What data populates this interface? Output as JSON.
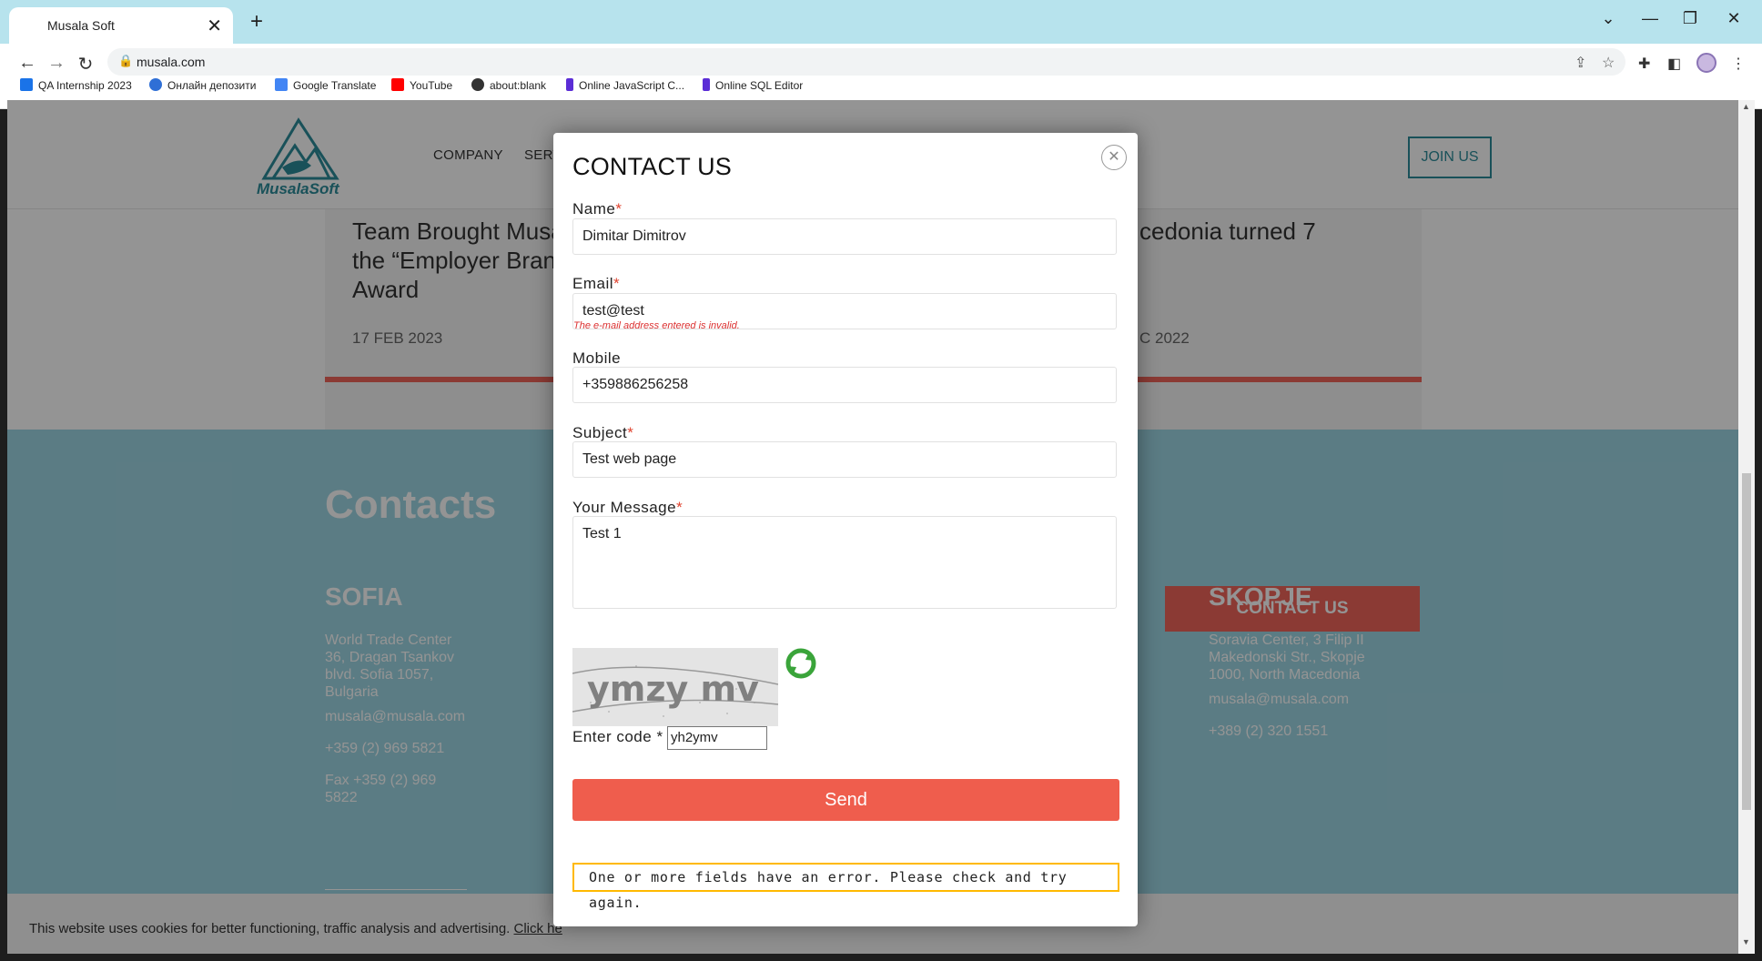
{
  "browser": {
    "tab_title": "Musala Soft",
    "url": "musala.com",
    "bookmarks": [
      {
        "label": "QA Internship 2023",
        "color": "#1a73e8"
      },
      {
        "label": "Онлайн депозити",
        "color": "#2f6fd6"
      },
      {
        "label": "Google Translate",
        "color": "#4285f4"
      },
      {
        "label": "YouTube",
        "color": "#ff0000"
      },
      {
        "label": "about:blank",
        "color": "#333333"
      },
      {
        "label": "Online JavaScript C...",
        "color": "#5b2dd6"
      },
      {
        "label": "Online SQL Editor",
        "color": "#5b2dd6"
      }
    ]
  },
  "site": {
    "logo_text": "MusalaSoft",
    "nav": [
      "COMPANY",
      "SERV"
    ],
    "join_label": "JOIN US",
    "news": [
      {
        "title": "Team Brought Musa\nthe “Employer Branc\nAward",
        "date": "17 FEB 2023"
      },
      {
        "title": "cedonia turned 7",
        "date": "C 2022"
      }
    ],
    "contacts": {
      "heading": "Contacts",
      "contact_button": "CONTACT US",
      "sofia": {
        "city": "SOFIA",
        "address": "World Trade Center\n36, Dragan Tsankov\nblvd. Sofia 1057,\nBulgaria",
        "email": "musala@musala.com",
        "phone": "+359 (2) 969 5821",
        "fax": "Fax +359 (2) 969\n5822"
      },
      "skopje": {
        "city": "SKOPJE",
        "address": "Soravia Center, 3 Filip II\nMakedonski Str., Skopje\n1000, North Macedonia",
        "email": "musala@musala.com",
        "phone": "+389 (2) 320 1551"
      }
    },
    "cookie": {
      "text": "This website uses cookies for better functioning, traffic analysis and advertising.",
      "link": "Click he"
    }
  },
  "modal": {
    "title": "CONTACT US",
    "name_label": "Name",
    "name_value": "Dimitar Dimitrov",
    "email_label": "Email",
    "email_value": "test@test",
    "email_error": "The e-mail address entered is invalid.",
    "mobile_label": "Mobile",
    "mobile_value": "+359886256258",
    "subject_label": "Subject",
    "subject_value": "Test web page",
    "message_label": "Your Message",
    "message_value": "Test 1",
    "captcha_text": "ymzy mv",
    "code_label": "Enter code *",
    "code_value": "yh2ymv",
    "send_label": "Send",
    "form_error": "One or more fields have an error. Please check and try again."
  },
  "colors": {
    "accent": "#ef5d4d",
    "teal": "#2c8c9a",
    "error": "#dc3232",
    "warning_border": "#ffb900"
  }
}
